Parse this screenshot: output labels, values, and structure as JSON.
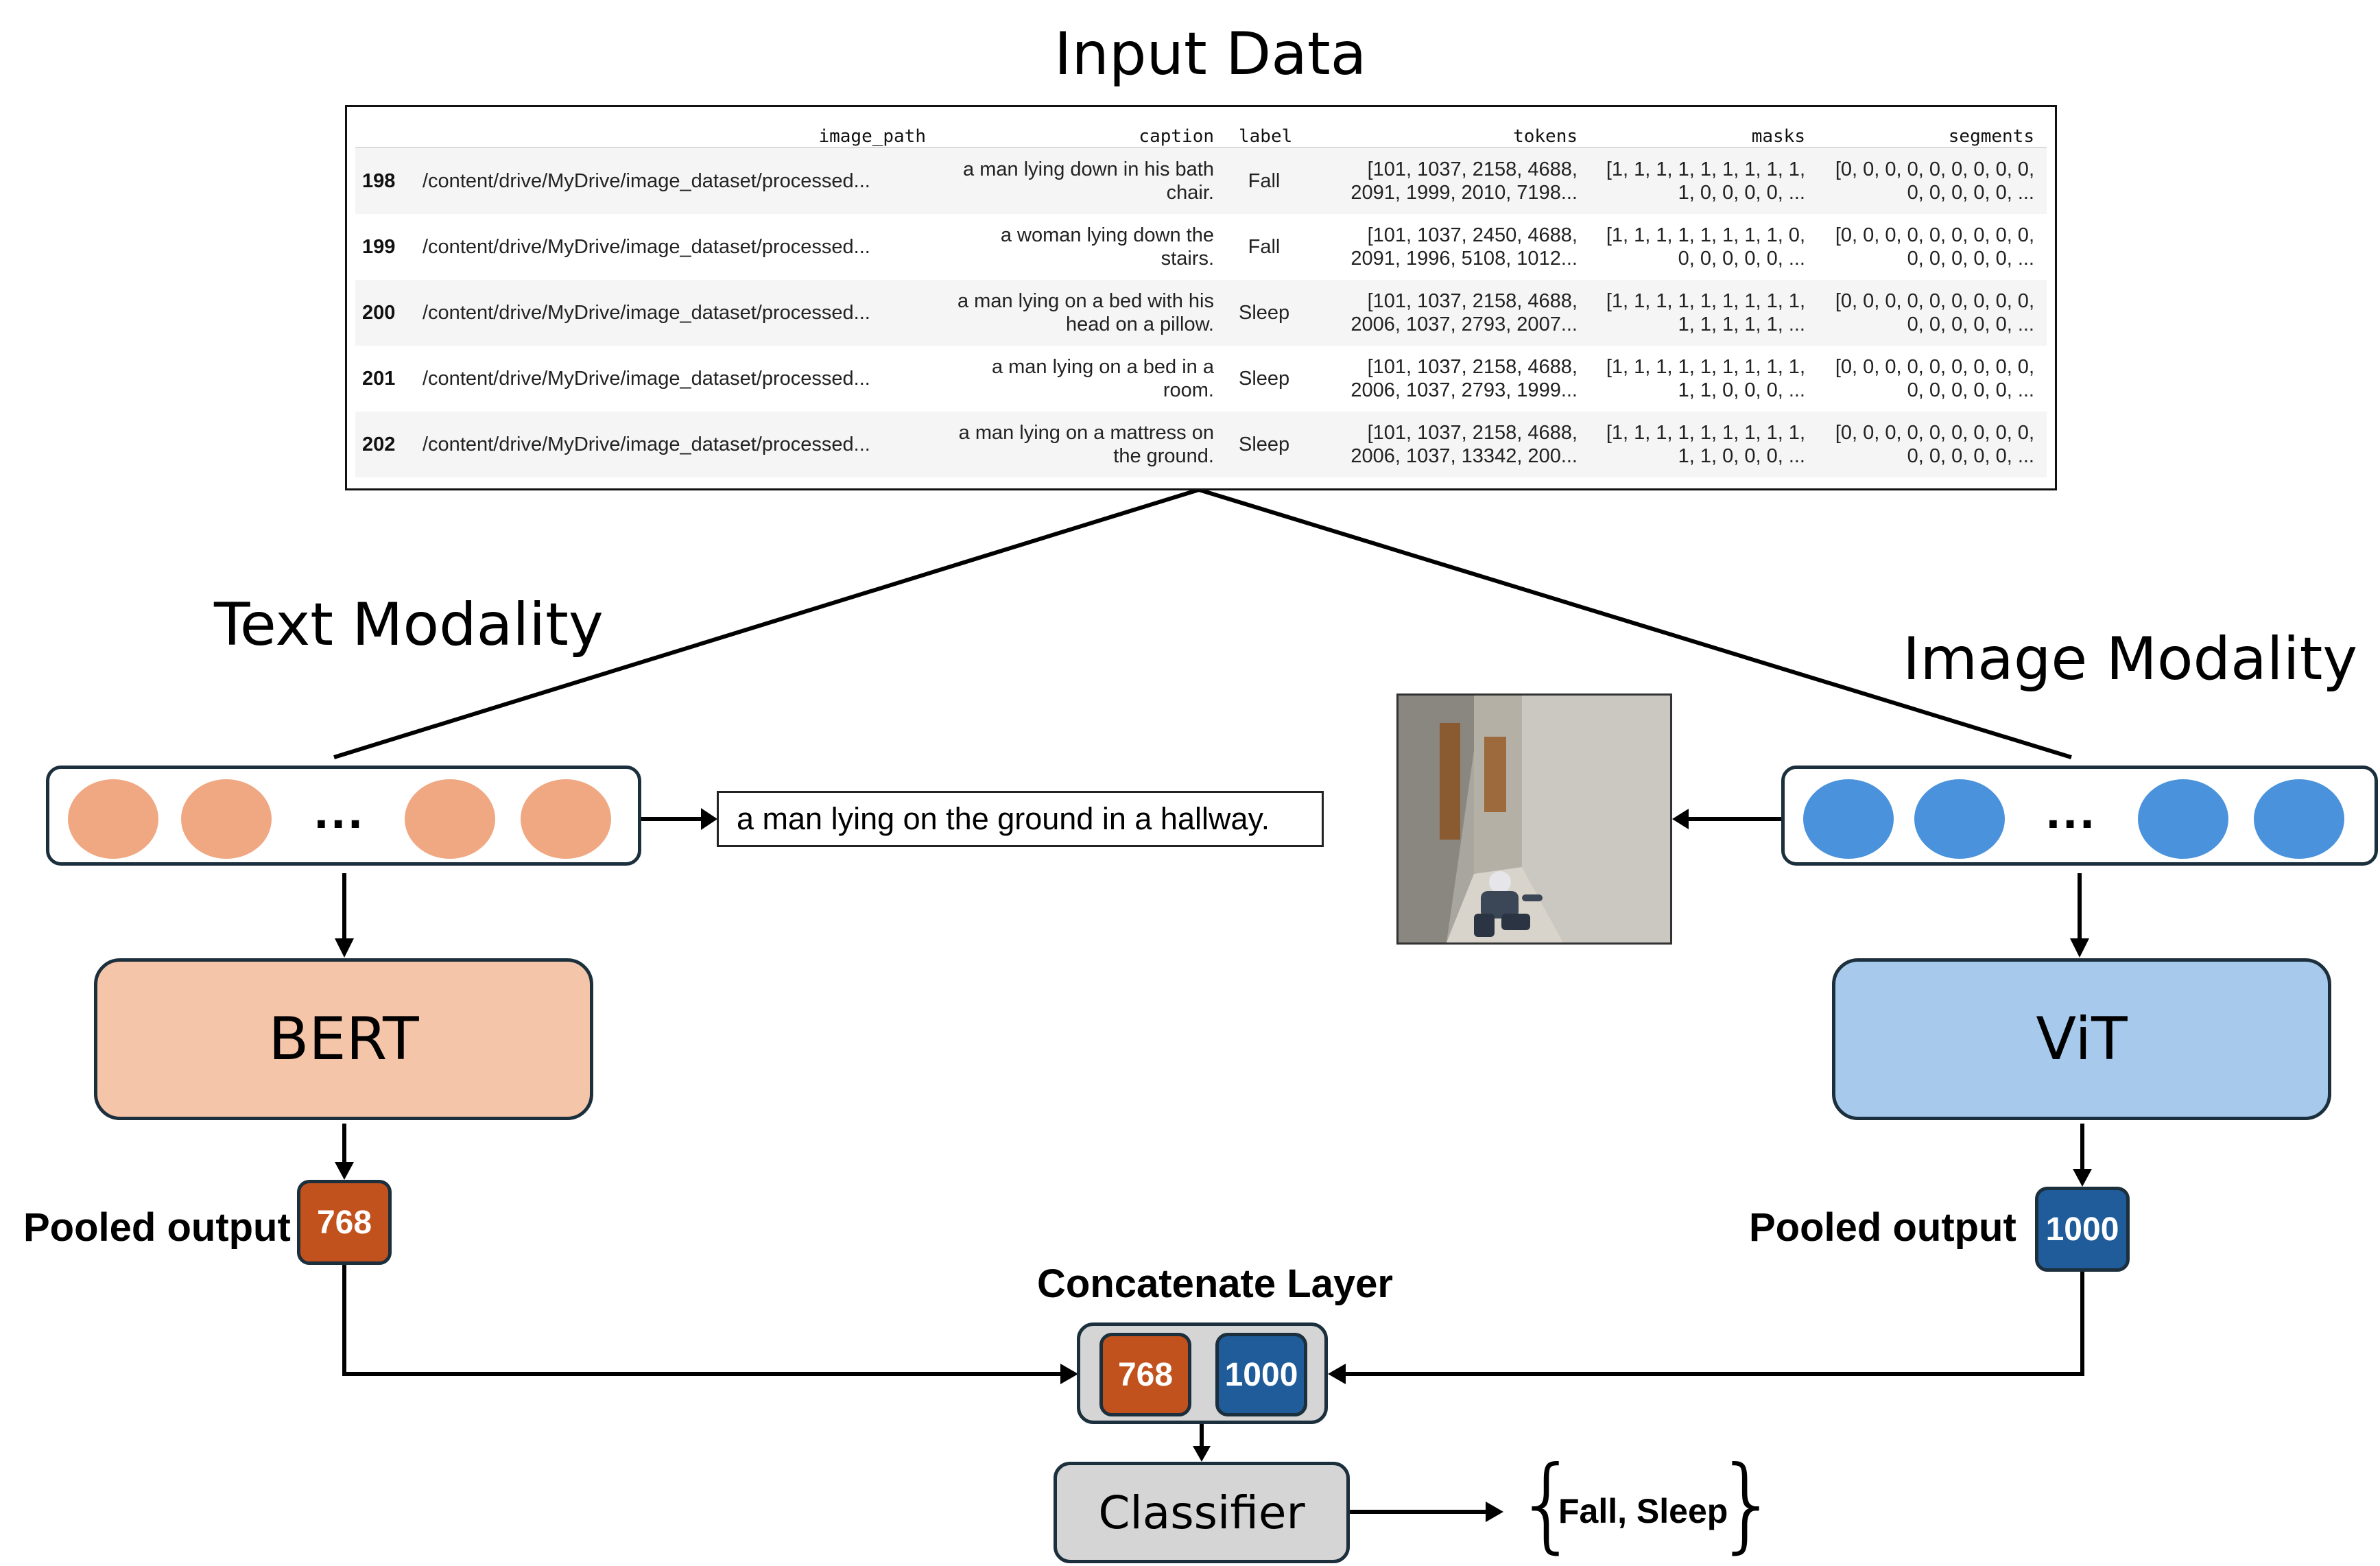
{
  "titles": {
    "input_data": "Input Data",
    "text_modality": "Text Modality",
    "image_modality": "Image Modality",
    "concatenate_layer": "Concatenate Layer"
  },
  "table": {
    "headers": [
      "",
      "image_path",
      "caption",
      "label",
      "tokens",
      "masks",
      "segments"
    ],
    "rows": [
      {
        "index": "198",
        "image_path": "/content/drive/MyDrive/image_dataset/processed...",
        "caption": "a man lying down in his bath chair.",
        "label": "Fall",
        "tokens": "[101, 1037, 2158, 4688, 2091, 1999, 2010, 7198...",
        "masks": "[1, 1, 1, 1, 1, 1, 1, 1, 1, 1, 0, 0, 0, 0, ...",
        "segments": "[0, 0, 0, 0, 0, 0, 0, 0, 0, 0, 0, 0, 0, 0, ..."
      },
      {
        "index": "199",
        "image_path": "/content/drive/MyDrive/image_dataset/processed...",
        "caption": "a woman lying down the stairs.",
        "label": "Fall",
        "tokens": "[101, 1037, 2450, 4688, 2091, 1996, 5108, 1012...",
        "masks": "[1, 1, 1, 1, 1, 1, 1, 1, 0, 0, 0, 0, 0, 0, ...",
        "segments": "[0, 0, 0, 0, 0, 0, 0, 0, 0, 0, 0, 0, 0, 0, ..."
      },
      {
        "index": "200",
        "image_path": "/content/drive/MyDrive/image_dataset/processed...",
        "caption": "a man lying on a bed with his head on a pillow.",
        "label": "Sleep",
        "tokens": "[101, 1037, 2158, 4688, 2006, 1037, 2793, 2007...",
        "masks": "[1, 1, 1, 1, 1, 1, 1, 1, 1, 1, 1, 1, 1, 1, ...",
        "segments": "[0, 0, 0, 0, 0, 0, 0, 0, 0, 0, 0, 0, 0, 0, ..."
      },
      {
        "index": "201",
        "image_path": "/content/drive/MyDrive/image_dataset/processed...",
        "caption": "a man lying on a bed in a room.",
        "label": "Sleep",
        "tokens": "[101, 1037, 2158, 4688, 2006, 1037, 2793, 1999...",
        "masks": "[1, 1, 1, 1, 1, 1, 1, 1, 1, 1, 1, 0, 0, 0, ...",
        "segments": "[0, 0, 0, 0, 0, 0, 0, 0, 0, 0, 0, 0, 0, 0, ..."
      },
      {
        "index": "202",
        "image_path": "/content/drive/MyDrive/image_dataset/processed...",
        "caption": "a man lying on a mattress on the ground.",
        "label": "Sleep",
        "tokens": "[101, 1037, 2158, 4688, 2006, 1037, 13342, 200...",
        "masks": "[1, 1, 1, 1, 1, 1, 1, 1, 1, 1, 1, 0, 0, 0, ...",
        "segments": "[0, 0, 0, 0, 0, 0, 0, 0, 0, 0, 0, 0, 0, 0, ..."
      }
    ]
  },
  "text_branch": {
    "ellipsis": "...",
    "caption_example": "a man lying on the ground in a hallway.",
    "model": "BERT",
    "pooled_label": "Pooled output",
    "pooled_size": "768",
    "circle_color": "#f0a883",
    "model_color": "#f5c5a9",
    "vector_color": "#c2521d"
  },
  "image_branch": {
    "ellipsis": "...",
    "model": "ViT",
    "pooled_label": "Pooled output",
    "pooled_size": "1000",
    "circle_color": "#4a92dc",
    "model_color": "#a6c9ec",
    "vector_color": "#1f5c99"
  },
  "fusion": {
    "text_size": "768",
    "image_size": "1000",
    "classifier": "Classifier",
    "classes": "Fall, Sleep"
  }
}
